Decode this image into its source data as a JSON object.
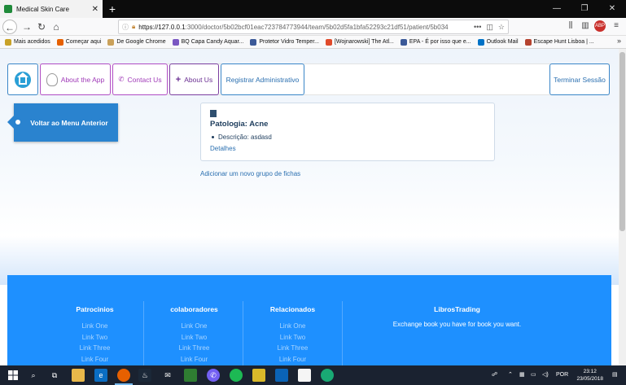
{
  "browser": {
    "tab_title": "Medical Skin Care",
    "tab_close": "✕",
    "new_tab": "+",
    "window_controls": [
      "—",
      "❐",
      "✕"
    ],
    "url_host": "https://127.0.0.1",
    "url_path": ":3000/doctor/5b02bcf01eac723784773944/team/5b02d5fa1bfa52293c21df51/patient/5b034",
    "url_more": "•••",
    "bookmarks": [
      {
        "label": "Mais acedidos",
        "color": "#c9a227"
      },
      {
        "label": "Começar aqui",
        "color": "#e66000"
      },
      {
        "label": "De Google Chrome",
        "color": "#caa15a"
      },
      {
        "label": "BQ Capa Candy Aquar...",
        "color": "#7a57c2"
      },
      {
        "label": "Protetor Vidro Temper...",
        "color": "#3b5998"
      },
      {
        "label": "[Wojnarowski] The Atl...",
        "color": "#e04a2a"
      },
      {
        "label": "EPA - É por isso que e...",
        "color": "#3b5998"
      },
      {
        "label": "Outlook Mail",
        "color": "#0072c6"
      },
      {
        "label": "Escape Hunt Lisboa | ...",
        "color": "#b5432f"
      }
    ],
    "bookmarks_more": "»"
  },
  "nav": {
    "about_app": "About the App",
    "contact": "Contact Us",
    "about_us": "About Us",
    "admin": "Registrar Administrativo",
    "logout": "Terminar Sessão"
  },
  "back_button": "Voltar ao Menu Anterior",
  "card": {
    "title": "Patologia: Acne",
    "description": "Descrição: asdasd",
    "details_link": "Detalhes"
  },
  "add_link": "Adicionar um novo grupo de fichas",
  "footer": {
    "columns": [
      {
        "title": "Patrocinios",
        "links": [
          "Link One",
          "Link Two",
          "Link Three",
          "Link Four"
        ]
      },
      {
        "title": "colaboradores",
        "links": [
          "Link One",
          "Link Two",
          "Link Three",
          "Link Four"
        ]
      },
      {
        "title": "Relacionados",
        "links": [
          "Link One",
          "Link Two",
          "Link Three",
          "Link Four"
        ]
      }
    ],
    "books_title": "LibrosTrading",
    "books_text": "Exchange book you have for book you want."
  },
  "taskbar": {
    "lang": "POR",
    "time": "23:12",
    "date": "23/05/2018"
  },
  "colors": {
    "accent_blue": "#2a83cf",
    "footer_blue": "#1e90ff",
    "nav_purple": "#a03bb8"
  }
}
